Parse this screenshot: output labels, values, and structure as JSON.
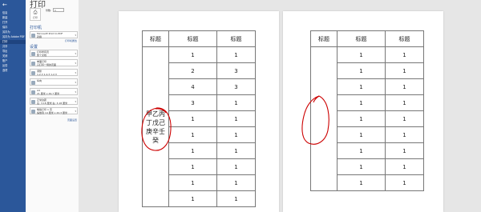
{
  "nav": {
    "back_label": "←",
    "items": [
      "信息",
      "新建",
      "打开",
      "保存",
      "另存为",
      "另存为 Adobe PDF",
      "打印",
      "共享",
      "导出",
      "关闭",
      "账户",
      "反馈",
      "选项"
    ],
    "active_index": 6
  },
  "panel": {
    "title": "打印",
    "print_button_label": "打印",
    "copies_label": "份数:",
    "copies_value": "1",
    "printer_section": "打印机",
    "printer_name": "Microsoft Print to PDF",
    "printer_status": "就绪",
    "printer_props_link": "打印机属性",
    "settings_section": "设置",
    "settings": [
      {
        "title": "打印所有页",
        "sub": "整个文档"
      },
      {
        "title": "单面打印",
        "sub": "只打印一侧的页面"
      },
      {
        "title": "调整",
        "sub": "1,2,3  1,2,3  1,2,3"
      },
      {
        "title": "纵向",
        "sub": ""
      },
      {
        "title": "A4",
        "sub": "21 厘米 x 29.7 厘米"
      },
      {
        "title": "正常边距",
        "sub": "左: 3.18 厘米  右: 3.18 厘米"
      },
      {
        "title": "每版打印 1 页",
        "sub": "缩放到 14 厘米 x 20.3 厘米"
      }
    ],
    "page_setup_link": "页面设置"
  },
  "page1": {
    "headers": [
      "标题",
      "标题",
      "标题"
    ],
    "merged_text": "甲乙丙丁戊己庚辛壬癸",
    "rows": [
      [
        "1",
        "1"
      ],
      [
        "2",
        "3"
      ],
      [
        "4",
        "3"
      ],
      [
        "3",
        "1"
      ],
      [
        "1",
        "1"
      ],
      [
        "1",
        "1"
      ],
      [
        "1",
        "1"
      ],
      [
        "1",
        "1"
      ],
      [
        "1",
        "1"
      ],
      [
        "1",
        "1"
      ]
    ]
  },
  "page2": {
    "headers": [
      "标题",
      "标题",
      "标题"
    ],
    "rows": [
      [
        "1",
        "1"
      ],
      [
        "1",
        "1"
      ],
      [
        "1",
        "1"
      ],
      [
        "1",
        "1"
      ],
      [
        "1",
        "1"
      ],
      [
        "1",
        "1"
      ],
      [
        "1",
        "1"
      ],
      [
        "1",
        "1"
      ],
      [
        "1",
        "1"
      ]
    ]
  },
  "colors": {
    "nav_bg": "#2b579a",
    "annotation": "#cc0000"
  }
}
